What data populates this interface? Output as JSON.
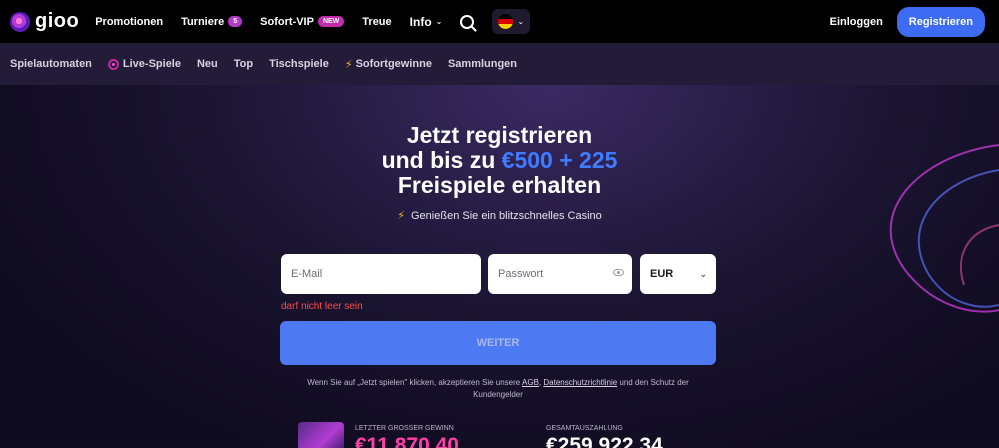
{
  "header": {
    "logo_text": "gioo",
    "nav": [
      {
        "label": "Promotionen"
      },
      {
        "label": "Turniere",
        "badge": "5"
      },
      {
        "label": "Sofort-VIP",
        "badge": "NEW"
      },
      {
        "label": "Treue"
      },
      {
        "label": "Info"
      }
    ],
    "login_label": "Einloggen",
    "register_label": "Registrieren",
    "icons": {
      "search": "search-icon",
      "language": "german-flag-icon",
      "dropdown": "chevron-down-icon"
    }
  },
  "categories": [
    {
      "label": "Spielautomaten"
    },
    {
      "label": "Live-Spiele",
      "icon": "live-icon"
    },
    {
      "label": "Neu"
    },
    {
      "label": "Top"
    },
    {
      "label": "Tischspiele"
    },
    {
      "label": "Sofortgewinne",
      "icon": "lightning-icon"
    },
    {
      "label": "Sammlungen"
    }
  ],
  "hero": {
    "line1": "Jetzt registrieren",
    "line2_prefix": "und bis zu ",
    "line2_accent": "€500 + 225",
    "line3": "Freispiele erhalten",
    "subtitle": "Genießen Sie ein blitzschnelles Casino"
  },
  "form": {
    "email_placeholder": "E-Mail",
    "password_placeholder": "Passwort",
    "currency_value": "EUR",
    "error": "darf nicht leer sein",
    "submit_label": "WEITER",
    "terms_prefix": "Wenn Sie auf „Jetzt spielen\" klicken, akzeptieren Sie unsere ",
    "terms_agb": "AGB",
    "terms_sep": ", ",
    "terms_privacy": "Datenschutzrichtlinie",
    "terms_suffix": " und den Schutz der Kundengelder"
  },
  "stats": {
    "last_win_label": "LETZTER GROSSER GEWINN",
    "last_win_value": "€11 870,40",
    "total_label": "GESAMTAUSZAHLUNG",
    "total_value": "€259 922,34"
  },
  "colors": {
    "accent_blue": "#3d6cf2",
    "accent_text": "#3f7cff",
    "error_red": "#ff4a4a",
    "pink": "#ff3fa8"
  }
}
